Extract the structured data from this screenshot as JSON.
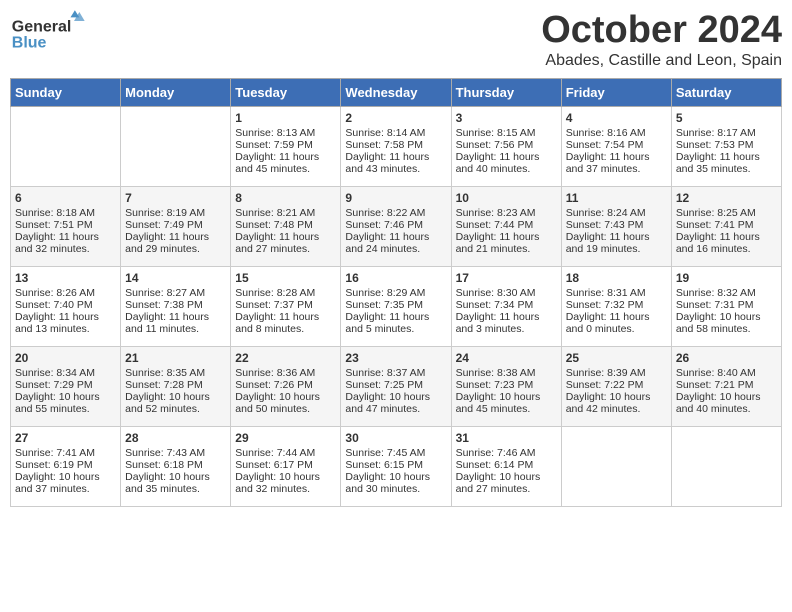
{
  "header": {
    "logo_general": "General",
    "logo_blue": "Blue",
    "month_title": "October 2024",
    "subtitle": "Abades, Castille and Leon, Spain"
  },
  "weekdays": [
    "Sunday",
    "Monday",
    "Tuesday",
    "Wednesday",
    "Thursday",
    "Friday",
    "Saturday"
  ],
  "weeks": [
    [
      {
        "day": "",
        "info": ""
      },
      {
        "day": "",
        "info": ""
      },
      {
        "day": "1",
        "info": "Sunrise: 8:13 AM\nSunset: 7:59 PM\nDaylight: 11 hours and 45 minutes."
      },
      {
        "day": "2",
        "info": "Sunrise: 8:14 AM\nSunset: 7:58 PM\nDaylight: 11 hours and 43 minutes."
      },
      {
        "day": "3",
        "info": "Sunrise: 8:15 AM\nSunset: 7:56 PM\nDaylight: 11 hours and 40 minutes."
      },
      {
        "day": "4",
        "info": "Sunrise: 8:16 AM\nSunset: 7:54 PM\nDaylight: 11 hours and 37 minutes."
      },
      {
        "day": "5",
        "info": "Sunrise: 8:17 AM\nSunset: 7:53 PM\nDaylight: 11 hours and 35 minutes."
      }
    ],
    [
      {
        "day": "6",
        "info": "Sunrise: 8:18 AM\nSunset: 7:51 PM\nDaylight: 11 hours and 32 minutes."
      },
      {
        "day": "7",
        "info": "Sunrise: 8:19 AM\nSunset: 7:49 PM\nDaylight: 11 hours and 29 minutes."
      },
      {
        "day": "8",
        "info": "Sunrise: 8:21 AM\nSunset: 7:48 PM\nDaylight: 11 hours and 27 minutes."
      },
      {
        "day": "9",
        "info": "Sunrise: 8:22 AM\nSunset: 7:46 PM\nDaylight: 11 hours and 24 minutes."
      },
      {
        "day": "10",
        "info": "Sunrise: 8:23 AM\nSunset: 7:44 PM\nDaylight: 11 hours and 21 minutes."
      },
      {
        "day": "11",
        "info": "Sunrise: 8:24 AM\nSunset: 7:43 PM\nDaylight: 11 hours and 19 minutes."
      },
      {
        "day": "12",
        "info": "Sunrise: 8:25 AM\nSunset: 7:41 PM\nDaylight: 11 hours and 16 minutes."
      }
    ],
    [
      {
        "day": "13",
        "info": "Sunrise: 8:26 AM\nSunset: 7:40 PM\nDaylight: 11 hours and 13 minutes."
      },
      {
        "day": "14",
        "info": "Sunrise: 8:27 AM\nSunset: 7:38 PM\nDaylight: 11 hours and 11 minutes."
      },
      {
        "day": "15",
        "info": "Sunrise: 8:28 AM\nSunset: 7:37 PM\nDaylight: 11 hours and 8 minutes."
      },
      {
        "day": "16",
        "info": "Sunrise: 8:29 AM\nSunset: 7:35 PM\nDaylight: 11 hours and 5 minutes."
      },
      {
        "day": "17",
        "info": "Sunrise: 8:30 AM\nSunset: 7:34 PM\nDaylight: 11 hours and 3 minutes."
      },
      {
        "day": "18",
        "info": "Sunrise: 8:31 AM\nSunset: 7:32 PM\nDaylight: 11 hours and 0 minutes."
      },
      {
        "day": "19",
        "info": "Sunrise: 8:32 AM\nSunset: 7:31 PM\nDaylight: 10 hours and 58 minutes."
      }
    ],
    [
      {
        "day": "20",
        "info": "Sunrise: 8:34 AM\nSunset: 7:29 PM\nDaylight: 10 hours and 55 minutes."
      },
      {
        "day": "21",
        "info": "Sunrise: 8:35 AM\nSunset: 7:28 PM\nDaylight: 10 hours and 52 minutes."
      },
      {
        "day": "22",
        "info": "Sunrise: 8:36 AM\nSunset: 7:26 PM\nDaylight: 10 hours and 50 minutes."
      },
      {
        "day": "23",
        "info": "Sunrise: 8:37 AM\nSunset: 7:25 PM\nDaylight: 10 hours and 47 minutes."
      },
      {
        "day": "24",
        "info": "Sunrise: 8:38 AM\nSunset: 7:23 PM\nDaylight: 10 hours and 45 minutes."
      },
      {
        "day": "25",
        "info": "Sunrise: 8:39 AM\nSunset: 7:22 PM\nDaylight: 10 hours and 42 minutes."
      },
      {
        "day": "26",
        "info": "Sunrise: 8:40 AM\nSunset: 7:21 PM\nDaylight: 10 hours and 40 minutes."
      }
    ],
    [
      {
        "day": "27",
        "info": "Sunrise: 7:41 AM\nSunset: 6:19 PM\nDaylight: 10 hours and 37 minutes."
      },
      {
        "day": "28",
        "info": "Sunrise: 7:43 AM\nSunset: 6:18 PM\nDaylight: 10 hours and 35 minutes."
      },
      {
        "day": "29",
        "info": "Sunrise: 7:44 AM\nSunset: 6:17 PM\nDaylight: 10 hours and 32 minutes."
      },
      {
        "day": "30",
        "info": "Sunrise: 7:45 AM\nSunset: 6:15 PM\nDaylight: 10 hours and 30 minutes."
      },
      {
        "day": "31",
        "info": "Sunrise: 7:46 AM\nSunset: 6:14 PM\nDaylight: 10 hours and 27 minutes."
      },
      {
        "day": "",
        "info": ""
      },
      {
        "day": "",
        "info": ""
      }
    ]
  ]
}
